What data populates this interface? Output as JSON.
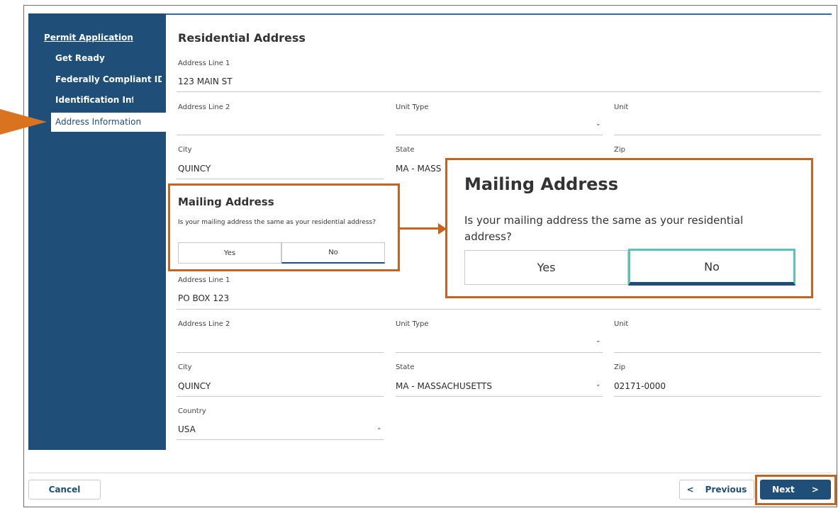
{
  "sidebar": {
    "title": "Permit Application",
    "items": [
      {
        "label": "Get Ready"
      },
      {
        "label": "Federally Compliant ID"
      },
      {
        "label": "Identification Informatic"
      },
      {
        "label": "Address Information"
      }
    ]
  },
  "residential": {
    "heading": "Residential Address",
    "address_line1_label": "Address Line 1",
    "address_line1_value": "123 MAIN ST",
    "address_line2_label": "Address Line 2",
    "address_line2_value": "",
    "unit_type_label": "Unit Type",
    "unit_label": "Unit",
    "city_label": "City",
    "city_value": "QUINCY",
    "state_label": "State",
    "state_value": "MA - MASS",
    "zip_label": "Zip"
  },
  "mailing_small": {
    "heading": "Mailing Address",
    "question": "Is your mailing address the same as your residential address?",
    "yes": "Yes",
    "no": "No"
  },
  "mailing_zoom": {
    "heading": "Mailing Address",
    "question": "Is your mailing address the same as your residential address?",
    "yes": "Yes",
    "no": "No"
  },
  "mailing": {
    "address_line1_label": "Address Line 1",
    "address_line1_value": "PO BOX 123",
    "address_line2_label": "Address Line 2",
    "unit_type_label": "Unit Type",
    "unit_label": "Unit",
    "city_label": "City",
    "city_value": "QUINCY",
    "state_label": "State",
    "state_value": "MA - MASSACHUSETTS",
    "zip_label": "Zip",
    "zip_value": "02171-0000",
    "country_label": "Country",
    "country_value": "USA"
  },
  "footer": {
    "cancel": "Cancel",
    "previous": "Previous",
    "next": "Next"
  },
  "colors": {
    "sidebar_bg": "#1f4e79",
    "highlight": "#c4641e",
    "pointer": "#d9731f",
    "selected_outline": "#5cc4b2"
  }
}
